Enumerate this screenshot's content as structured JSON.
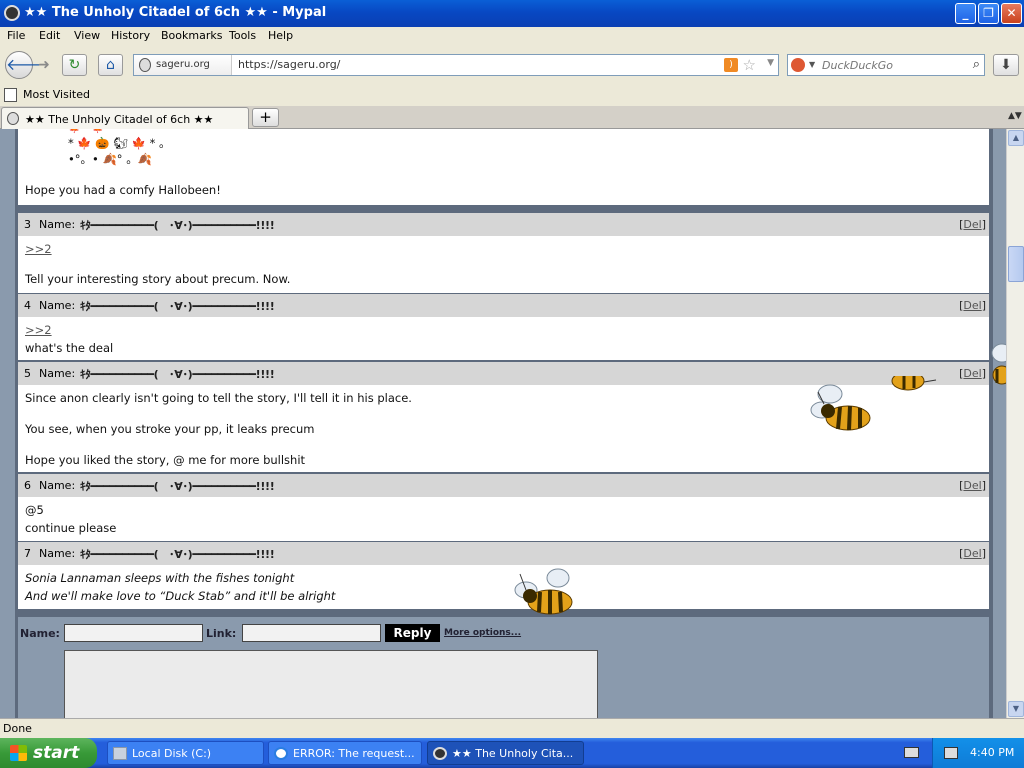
{
  "window": {
    "title": "★★ The Unholy Citadel of 6ch ★★ - Mypal",
    "minimize": "_",
    "maximize": "❐",
    "close": "✕"
  },
  "menu": [
    "File",
    "Edit",
    "View",
    "History",
    "Bookmarks",
    "Tools",
    "Help"
  ],
  "nav": {
    "site_identity": "sageru.org",
    "url": "https://sageru.org/",
    "search_placeholder": "DuckDuckGo"
  },
  "bookmarks": {
    "most_visited": "Most Visited"
  },
  "tab": {
    "label": "★★ The Unholy Citadel of 6ch ★★",
    "new_tab": "+"
  },
  "thread": {
    "top_post": {
      "art_lines": [
        "* 🍁 🎃 🐿 🍁 * 。",
        "•°。• 🍂° 。🍂"
      ],
      "text": "Hope you had a comfy Hallobeen!"
    },
    "name_label": "Name:",
    "poster_name": "ｷﾀ━━━━━━━━━━(　･∀･)━━━━━━━━━━!!!!",
    "del_label": "Del",
    "posts": [
      {
        "num": "3",
        "lines": [
          ">>2",
          "",
          "Tell your interesting story about precum. Now."
        ]
      },
      {
        "num": "4",
        "lines": [
          ">>2",
          "what's the deal"
        ]
      },
      {
        "num": "5",
        "lines": [
          "Since anon clearly isn't going to tell the story, I'll tell it in his place.",
          "You see, when you stroke your pp, it leaks precum",
          "Hope you liked the story, @ me for more bullshit"
        ]
      },
      {
        "num": "6",
        "lines": [
          "@5",
          "continue please"
        ]
      },
      {
        "num": "7",
        "lines": [
          "Sonia Lannaman sleeps with the fishes tonight",
          "And we'll make love to “Duck Stab” and it'll be alright"
        ]
      }
    ]
  },
  "reply_form": {
    "name_label": "Name:",
    "link_label": "Link:",
    "reply_button": "Reply",
    "more_options": "More options..."
  },
  "status": "Done",
  "taskbar": {
    "start": "start",
    "tasks": [
      "Local Disk (C:)",
      "ERROR: The request...",
      "★★ The Unholy Cita..."
    ],
    "clock": "4:40 PM"
  }
}
